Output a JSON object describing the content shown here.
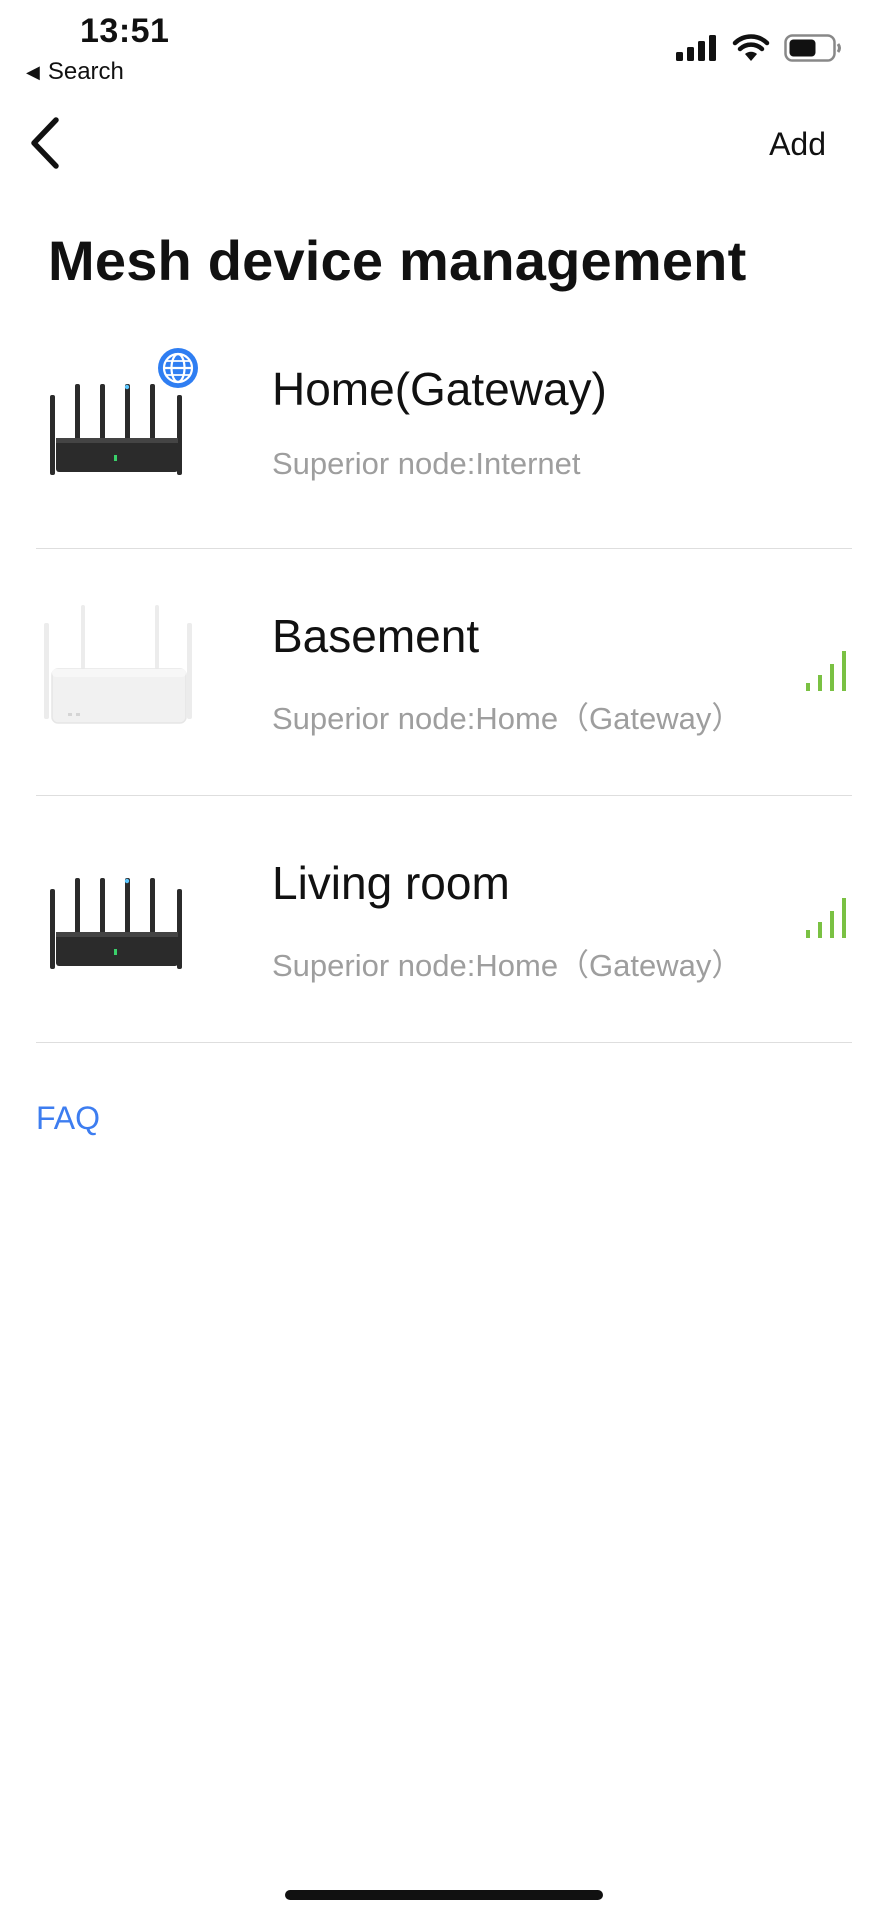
{
  "status_bar": {
    "time": "13:51",
    "back_label": "Search",
    "back_arrow": "◀"
  },
  "nav": {
    "add_label": "Add"
  },
  "title": "Mesh device management",
  "devices": [
    {
      "name": "Home(Gateway)",
      "superior": "Superior node:Internet",
      "model_icon": "router-dark-icon",
      "badge": "globe-icon",
      "signal": null
    },
    {
      "name": "Basement",
      "superior": "Superior node:Home（Gateway）",
      "model_icon": "router-white-icon",
      "signal": "good"
    },
    {
      "name": "Living room",
      "superior": "Superior node:Home（Gateway）",
      "model_icon": "router-dark-icon",
      "signal": "good"
    }
  ],
  "faq_label": "FAQ",
  "colors": {
    "accent": "#3d7df0",
    "signal": "#7ac143",
    "subtext": "#9e9e9e",
    "divider": "#dedede"
  }
}
